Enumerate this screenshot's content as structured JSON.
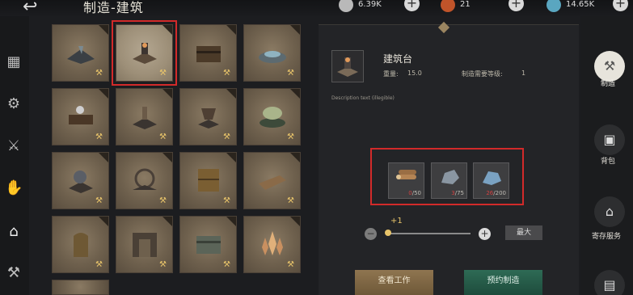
{
  "header": {
    "back_icon": "back-arrow-icon",
    "title": "制造-建筑",
    "resources": [
      {
        "icon": "silver-coin-icon",
        "value": "6.39K",
        "color": "#b9b9b9"
      },
      {
        "icon": "flame-token-icon",
        "value": "21",
        "color": "#c0542a"
      },
      {
        "icon": "crystal-icon",
        "value": "14.65K",
        "color": "#5aa6c0"
      }
    ]
  },
  "sidebar": {
    "icons": [
      "grid-icon",
      "crafting-icon",
      "weapon-icon",
      "hand-icon",
      "building-icon",
      "tool-icon"
    ]
  },
  "grid": {
    "items": [
      {
        "name": "cell-0",
        "icon": "siege-icon"
      },
      {
        "name": "cell-1",
        "icon": "building-table-icon",
        "selected": true
      },
      {
        "name": "cell-2",
        "icon": "chest-icon"
      },
      {
        "name": "cell-3",
        "icon": "fountain-icon"
      },
      {
        "name": "cell-4",
        "icon": "workbench-icon"
      },
      {
        "name": "cell-5",
        "icon": "altar-icon"
      },
      {
        "name": "cell-6",
        "icon": "stand-icon"
      },
      {
        "name": "cell-7",
        "icon": "cauldron-icon"
      },
      {
        "name": "cell-8",
        "icon": "cannon-icon"
      },
      {
        "name": "cell-9",
        "icon": "wheel-icon"
      },
      {
        "name": "cell-10",
        "icon": "crate-icon"
      },
      {
        "name": "cell-11",
        "icon": "plank-icon"
      },
      {
        "name": "cell-12",
        "icon": "door-icon"
      },
      {
        "name": "cell-13",
        "icon": "gate-icon"
      },
      {
        "name": "cell-14",
        "icon": "box-icon"
      },
      {
        "name": "cell-15",
        "icon": "crystal-cluster-icon"
      },
      {
        "name": "cell-16",
        "icon": "partial-item-icon"
      }
    ]
  },
  "detail": {
    "name": "建筑台",
    "weight_label": "重量:",
    "weight_value": "15.0",
    "level_label": "制造需要等级:",
    "level_value": "1",
    "description": "Description text (illegible)",
    "materials": [
      {
        "icon": "wood-logs-icon",
        "have": "0",
        "need": "/50"
      },
      {
        "icon": "stone-icon",
        "have": "3",
        "need": "/75"
      },
      {
        "icon": "ore-icon",
        "have": "26",
        "need": "/200"
      }
    ],
    "quantity_step": "+1",
    "slider_level": 0.0,
    "max_label": "最大",
    "view_work_label": "查看工作",
    "reserve_label": "预约制造"
  },
  "right_menu": {
    "items": [
      {
        "icon": "hammer-icon",
        "label": "制造",
        "active": true
      },
      {
        "icon": "backpack-icon",
        "label": "背包",
        "active": false
      },
      {
        "icon": "storage-icon",
        "label": "寄存服务",
        "active": false
      },
      {
        "icon": "clipboard-icon",
        "label": "",
        "active": false
      }
    ]
  },
  "colors": {
    "highlight_red": "#d22a2a",
    "gold": "#e8c46a"
  }
}
